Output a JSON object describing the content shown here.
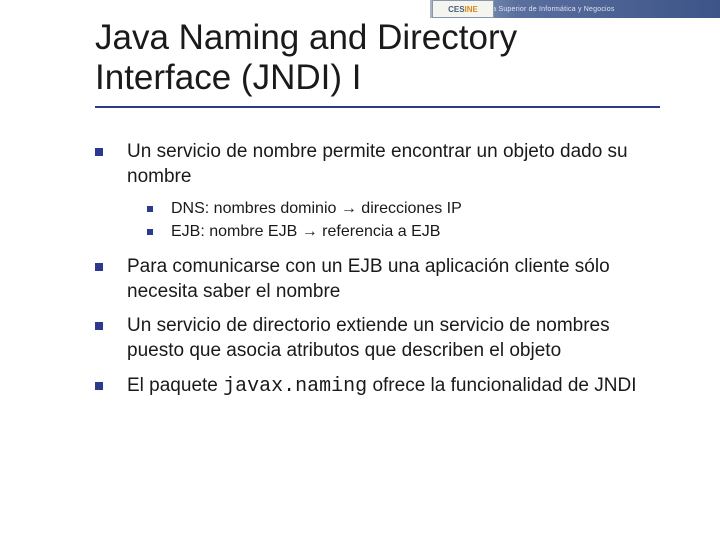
{
  "header": {
    "logo_left": "CES",
    "logo_right": "INE",
    "tagline": "Escuela Superior de Informática y Negocios"
  },
  "title": "Java Naming and Directory Interface (JNDI) I",
  "bullets": [
    {
      "text": "Un servicio de nombre permite encontrar un objeto dado su nombre",
      "sub": [
        "DNS: nombres dominio → direcciones IP",
        "EJB: nombre EJB → referencia a EJB"
      ]
    },
    {
      "text": "Para comunicarse con un EJB una aplicación cliente sólo necesita saber el nombre"
    },
    {
      "text": "Un servicio de directorio extiende un servicio de nombres puesto que asocia atributos que describen el objeto"
    },
    {
      "text_pre": "El paquete ",
      "text_code": "javax.naming",
      "text_post": " ofrece la funcionalidad de JNDI"
    }
  ]
}
